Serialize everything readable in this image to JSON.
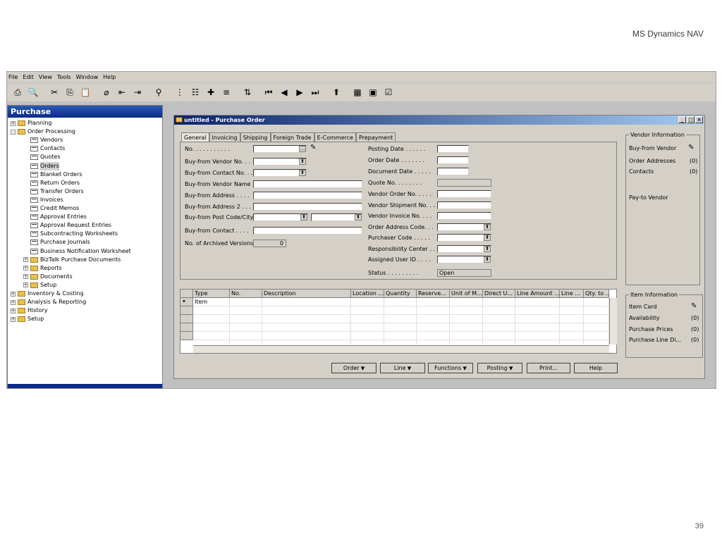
{
  "slide": {
    "header": "MS Dynamics NAV",
    "page": "39"
  },
  "menu": [
    "File",
    "Edit",
    "View",
    "Tools",
    "Window",
    "Help"
  ],
  "toolbar_icons": [
    "print-icon",
    "print-preview-icon",
    "cut-icon",
    "copy-icon",
    "paste-icon",
    "attach-icon",
    "indent-icon",
    "outdent-icon",
    "find-icon",
    "list-icon",
    "form-icon",
    "plus-icon",
    "menu-icon",
    "sort-icon",
    "first-icon",
    "prev-icon",
    "next-icon",
    "last-icon",
    "up-icon",
    "calendar-icon",
    "chart-icon",
    "check-icon"
  ],
  "nav": {
    "title": "Purchase",
    "items": [
      "Planning",
      "Order Processing",
      "Vendors",
      "Contacts",
      "Quotes",
      "Orders",
      "Blanket Orders",
      "Return Orders",
      "Transfer Orders",
      "Invoices",
      "Credit Memos",
      "Approval Entries",
      "Approval Request Entries",
      "Subcontracting Worksheets",
      "Purchase Journals",
      "Business Notification Worksheet",
      "BizTalk Purchase Documents",
      "Reports",
      "Documents",
      "Setup",
      "Inventory & Costing",
      "Analysis & Reporting",
      "History",
      "Setup"
    ]
  },
  "window": {
    "title": "untitled - Purchase Order"
  },
  "tabs": [
    "General",
    "Invoicing",
    "Shipping",
    "Foreign Trade",
    "E-Commerce",
    "Prepayment"
  ],
  "left_fields": [
    "No. . . . . . . . . . .",
    "Buy-from Vendor No. . .",
    "Buy-from Contact No. . .",
    "Buy-from Vendor Name  .",
    "Buy-from Address . . . .",
    "Buy-from Address 2 . . .",
    "Buy-from Post Code/City",
    "Buy-from Contact . . . .",
    "No. of Archived Versions."
  ],
  "archived_versions": "0",
  "right_fields": [
    "Posting Date . . . . . .",
    "Order Date . . . . . . .",
    "Document Date . . . . .",
    "Quote No. . . . . . . .",
    "Vendor Order No. . . . .",
    "Vendor Shipment No. . .",
    "Vendor Invoice No. . . .",
    "Order Address Code. . .",
    "Purchaser Code . . . . .",
    "Responsibility Center  . .",
    "Assigned User ID . . . .",
    "Status . . . . . . . . ."
  ],
  "status": "Open",
  "vendor_info": {
    "title": "Vendor Information",
    "vendor": "Buy-from Vendor",
    "order_addresses": "Order Addresses",
    "order_addresses_count": "(0)",
    "contacts": "Contacts",
    "contacts_count": "(0)",
    "pay_to": "Pay-to Vendor"
  },
  "item_info": {
    "title": "Item Information",
    "card": "Item Card",
    "availability": "Availability",
    "availability_count": "(0)",
    "prices": "Purchase Prices",
    "prices_count": "(0)",
    "line_disc": "Purchase Line Di...",
    "line_disc_count": "(0)"
  },
  "grid": {
    "columns": [
      "Type",
      "No.",
      "Description",
      "Location ...",
      "Quantity",
      "Reserve...",
      "Unit of M...",
      "Direct U...",
      "Line Amount ...",
      "Line ...",
      "Qty. to ..."
    ],
    "row1_type": "Item"
  },
  "buttons": [
    "Order",
    "Line",
    "Functions",
    "Posting",
    "Print...",
    "Help"
  ]
}
